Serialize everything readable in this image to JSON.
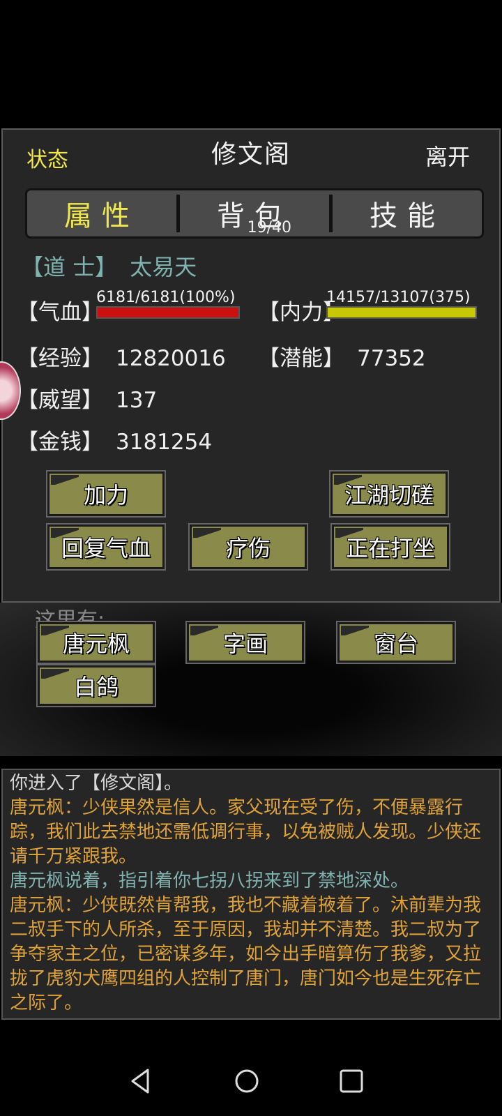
{
  "header": {
    "status": "状态",
    "title": "修文阁",
    "leave": "离开"
  },
  "tabs": [
    {
      "label": "属性",
      "active": true
    },
    {
      "label": "背包",
      "count": "19/40"
    },
    {
      "label": "技能"
    }
  ],
  "character": {
    "class_bracket_open": "【",
    "class": "道 士",
    "class_bracket_close": "】",
    "name": "太易天"
  },
  "stats": {
    "hp_label": "【气血】",
    "hp_text": "6181/6181(100%)",
    "hp_fraction": 1.0,
    "hp_color": "#cc1010",
    "mp_label": "【内力】",
    "mp_text": "14157/13107(375)",
    "mp_fraction": 1.0,
    "mp_color": "#c8c800",
    "exp_label": "【经验】",
    "exp": "12820016",
    "pot_label": "【潜能】",
    "pot": "77352",
    "rep_label": "【威望】",
    "rep": "137",
    "gold_label": "【金钱】",
    "gold": "3181254"
  },
  "actions": {
    "jiali": "加力",
    "jianghu": "江湖切磋",
    "heal_hp": "回复气血",
    "liaoshang": "疗伤",
    "dazuo": "正在打坐"
  },
  "here": {
    "label": "这里有:",
    "items": [
      "唐元枫",
      "字画",
      "窗台",
      "白鸽"
    ]
  },
  "log": [
    {
      "type": "sys",
      "text": "你进入了【修文阁】。"
    },
    {
      "type": "talk",
      "text": "唐元枫：少侠果然是信人。家父现在受了伤，不便暴露行踪，我们此去禁地还需低调行事，以免被贼人发现。少侠还请千万紧跟我。"
    },
    {
      "type": "act",
      "text": "唐元枫说着，指引着你七拐八拐来到了禁地深处。"
    },
    {
      "type": "talk",
      "text": "唐元枫：少侠既然肯帮我，我也不藏着掖着了。沐前辈为我二叔手下的人所杀，至于原因，我却并不清楚。我二叔为了争夺家主之位，已密谋多年，如今出手暗算伤了我爹，又拉拢了虎豹犬鹰四组的人控制了唐门，唐门如今也是生死存亡之际了。"
    }
  ],
  "colors": {
    "accent": "#f2e84a",
    "button": "#8a8a4a",
    "talk": "#e0a33a",
    "action": "#7fb3b0"
  }
}
